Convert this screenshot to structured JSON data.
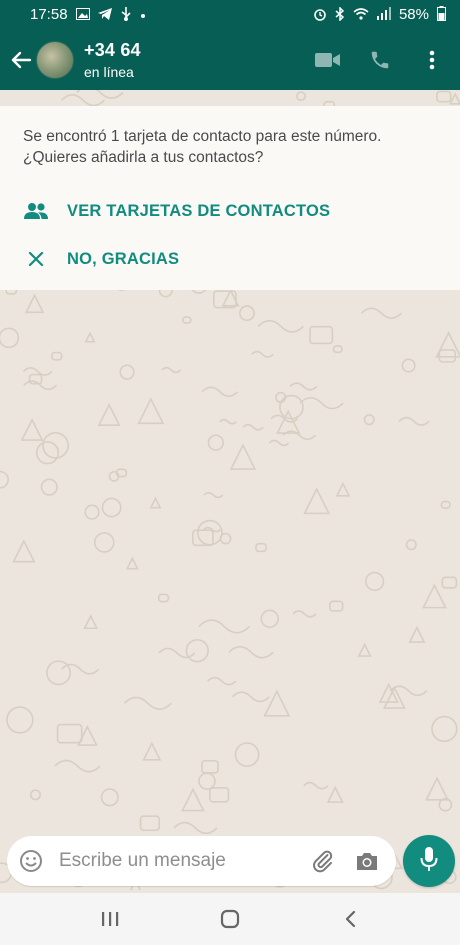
{
  "status_bar": {
    "time": "17:58",
    "battery": "58%",
    "icons_left": [
      "gallery-icon",
      "telegram-icon",
      "usb-icon",
      "dot-icon"
    ],
    "icons_right": [
      "alarm-icon",
      "bluetooth-icon",
      "wifi-icon",
      "signal-icon",
      "battery-icon"
    ]
  },
  "header": {
    "contact_name": "+34 64",
    "contact_status": "en línea",
    "actions": [
      "video-call-icon",
      "voice-call-icon",
      "more-options-icon"
    ]
  },
  "banner": {
    "message": "Se encontró 1 tarjeta de contacto para este número. ¿Quieres añadirla a tus contactos?",
    "primary_action": "VER TARJETAS DE CONTACTOS",
    "secondary_action": "NO, GRACIAS"
  },
  "composer": {
    "placeholder": "Escribe un mensaje"
  },
  "colors": {
    "header": "#075E54",
    "accent": "#128C7E",
    "wallpaper": "#ECE5DD"
  }
}
